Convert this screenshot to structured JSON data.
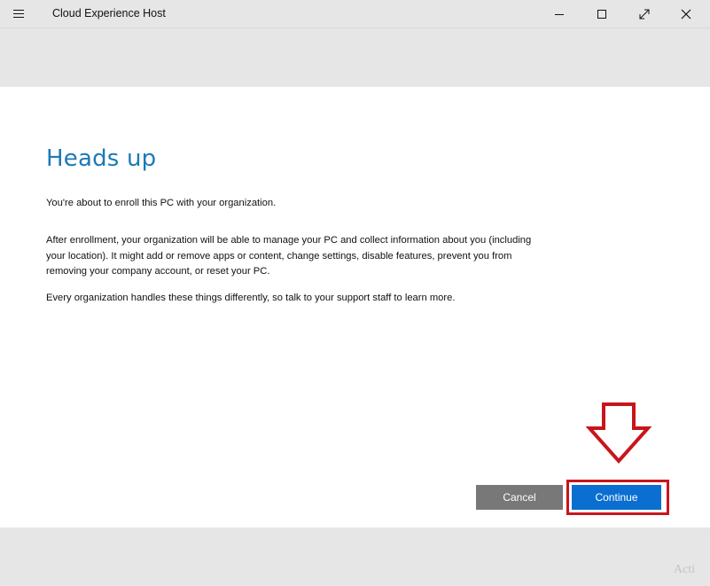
{
  "window": {
    "title": "Cloud Experience Host",
    "controls": [
      "minimize",
      "maximize",
      "restore",
      "close"
    ]
  },
  "dialog": {
    "heading": "Heads up",
    "paragraphs": [
      "You're about to enroll this PC with your organization.",
      "After enrollment, your organization will be able to manage your PC and collect information about you (including your location). It might add or remove apps or content, change settings, disable features, prevent you from removing your company account, or reset your PC.",
      "Every organization handles these things differently, so talk to your support staff to learn more."
    ],
    "buttons": {
      "cancel": "Cancel",
      "continue": "Continue"
    }
  },
  "annotation": {
    "arrow_color": "#c8151c",
    "box_color": "#c8151c"
  },
  "watermark": "Acti"
}
